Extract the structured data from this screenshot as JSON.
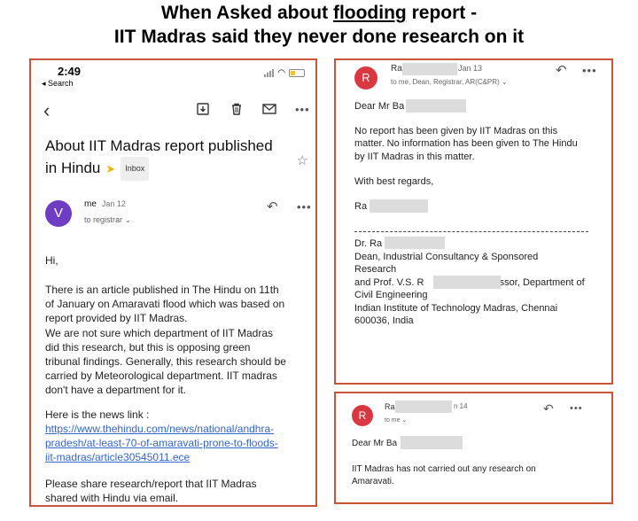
{
  "headline": {
    "pre": "When Asked about ",
    "underlined": "flooding",
    "post": " report -",
    "line2": "IIT Madras said they never done research on it"
  },
  "left_panel": {
    "status_time": "2:49",
    "back_label": "◂ Search",
    "subject_line1": "About IIT Madras report published",
    "subject_line2": "in Hindu",
    "inbox_label": "Inbox",
    "avatar_letter": "V",
    "sender": "me",
    "date": "Jan 12",
    "to": "to registrar ⌄",
    "greeting": "Hi,",
    "para1": [
      "There is an article published in The Hindu on 11th",
      "of January on Amaravati flood which was based on",
      "report provided by IIT Madras.",
      "We are not sure which department of IIT Madras",
      "did this research, but this is opposing green",
      "tribunal findings. Generally, this research should be",
      "carried by Meteorological department. IIT madras",
      "don't have a department for it."
    ],
    "news_label": "Here is the news link :",
    "link_lines": [
      "https://www.thehindu.com/news/national/andhra-",
      "pradesh/at-least-70-of-amaravati-prone-to-floods-",
      "iit-madras/article30545011.ece"
    ],
    "closing": [
      "Please share research/report that IIT Madras",
      "shared with Hindu via email."
    ]
  },
  "right_top": {
    "avatar_letter": "R",
    "sender_visible": "Ra",
    "date": "Jan 13",
    "to_line": "to me, Dean, Registrar, AR(C&PR) ⌄",
    "greeting": "Dear Mr Ba",
    "para": [
      "No report has been given by IIT Madras on this",
      "matter. No information has been given to The Hindu",
      "by IIT Madras in this matter."
    ],
    "regards": "With best regards,",
    "sign_name": "Ra",
    "sig_name": "Dr. Ra",
    "sig_lines": [
      "Dean, Industrial Consultancy & Sponsored",
      "Research"
    ],
    "sig_prof_a": "and Prof. V.S. R",
    "sig_prof_b": "fessor, Department of",
    "sig_lines2": [
      "Civil Engineering",
      "Indian Institute of Technology Madras, Chennai",
      "600036, India"
    ]
  },
  "right_bottom": {
    "avatar_letter": "R",
    "sender_visible": "Ra",
    "date": "n 14",
    "to_line": "to me ⌄",
    "greeting": "Dear Mr Ba",
    "para": [
      "IIT Madras has not carried out any research on",
      "Amaravati."
    ]
  },
  "colors": {
    "panel_border": "#c8543a",
    "avatar_v": "#6f3cc4",
    "avatar_r": "#d93840",
    "link": "#3366cc"
  }
}
